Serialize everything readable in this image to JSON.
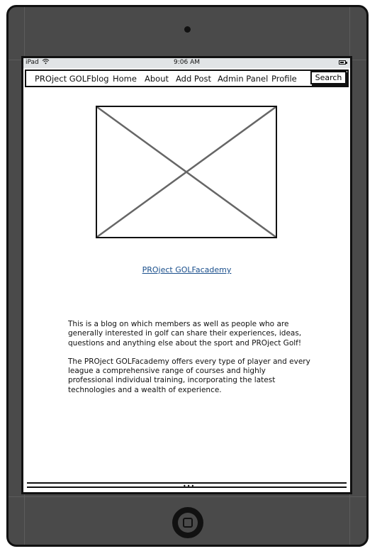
{
  "status_bar": {
    "carrier": "iPad",
    "time": "9:06 AM",
    "icons": [
      "wifi-icon",
      "battery-icon"
    ]
  },
  "navbar": {
    "brand": "PROject GOLFblog",
    "items": [
      {
        "label": "Home"
      },
      {
        "label": "About"
      },
      {
        "label": "Add Post"
      },
      {
        "label": "Admin Panel"
      },
      {
        "label": "Profile"
      }
    ],
    "search_label": "Search"
  },
  "main": {
    "image_placeholder": "image-placeholder",
    "academy_link": "PROject GOLFacademy",
    "paragraphs": [
      "This is a blog on which members as well as people who are generally interested in golf can share their experiences, ideas, questions and anything else about the sport and PROject Golf!",
      "The PROject GOLFacademy offers every type of player and every league a comprehensive range of courses and highly professional individual training, incorporating the latest technologies and a wealth of experience."
    ]
  },
  "colors": {
    "device_frame": "#4a4a4a",
    "status_bar_bg": "#e1e4e6",
    "link": "#1a4f8c"
  }
}
